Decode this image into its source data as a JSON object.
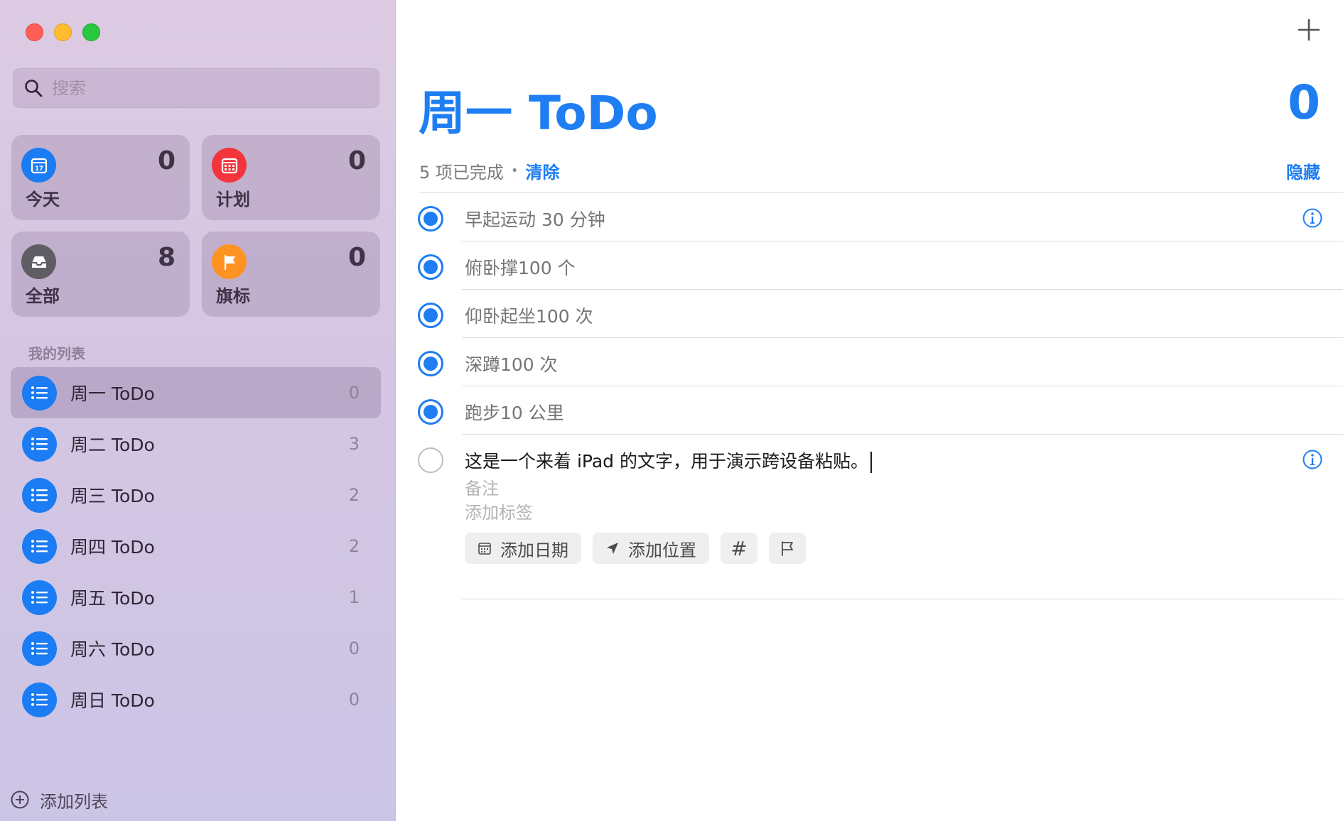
{
  "sidebar": {
    "search": {
      "placeholder": "搜索"
    },
    "smart_lists": [
      {
        "label": "今天",
        "count": "0",
        "color": "#1b7cf3",
        "icon": "calendar-today-icon"
      },
      {
        "label": "计划",
        "count": "0",
        "color": "#f4343c",
        "icon": "calendar-grid-icon"
      },
      {
        "label": "全部",
        "count": "8",
        "color": "#5d5d63",
        "icon": "tray-icon"
      },
      {
        "label": "旗标",
        "count": "0",
        "color": "#ff9321",
        "icon": "flag-icon"
      }
    ],
    "section_title": "我的列表",
    "lists": [
      {
        "name": "周一 ToDo",
        "count": "0",
        "selected": true
      },
      {
        "name": "周二 ToDo",
        "count": "3"
      },
      {
        "name": "周三 ToDo",
        "count": "2"
      },
      {
        "name": "周四 ToDo",
        "count": "2"
      },
      {
        "name": "周五 ToDo",
        "count": "1"
      },
      {
        "name": "周六 ToDo",
        "count": "0"
      },
      {
        "name": "周日 ToDo",
        "count": "0"
      }
    ],
    "add_list_label": "添加列表"
  },
  "main": {
    "title": "周一 ToDo",
    "count": "0",
    "completed_text": "5 项已完成",
    "clear_label": "清除",
    "hide_label": "隐藏",
    "tasks": [
      {
        "text": "早起运动 30 分钟",
        "done": true
      },
      {
        "text": "俯卧撑100 个",
        "done": true
      },
      {
        "text": "仰卧起坐100 次",
        "done": true
      },
      {
        "text": "深蹲100 次",
        "done": true
      },
      {
        "text": "跑步10 公里",
        "done": true
      }
    ],
    "editing_task": {
      "text": "这是一个来着 iPad 的文字，用于演示跨设备粘贴。",
      "notes_placeholder": "备注",
      "tags_placeholder": "添加标签",
      "add_date_label": "添加日期",
      "add_location_label": "添加位置",
      "tag_symbol": "#"
    },
    "accent_color": "#1e7ef2"
  }
}
